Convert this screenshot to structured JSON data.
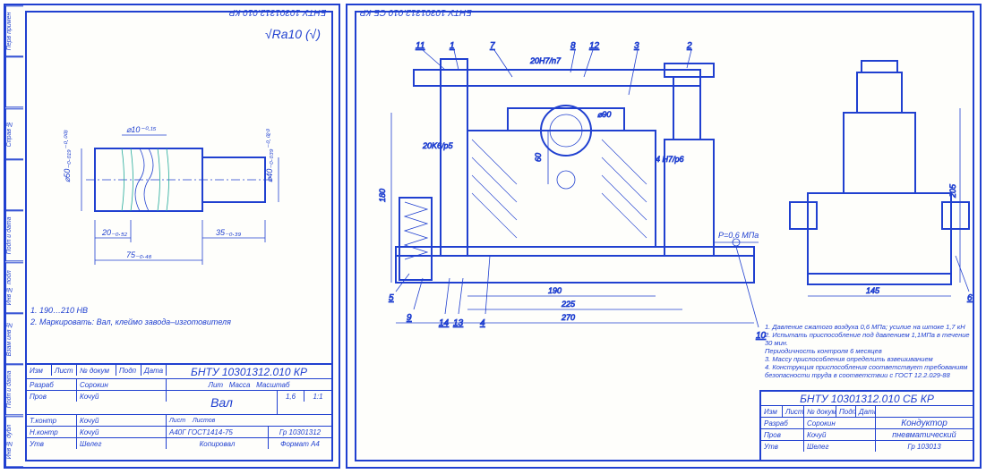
{
  "sheet_left": {
    "top_code": "БНТУ 10301312.010 КР",
    "ra_label": "Ra10",
    "dims": {
      "d10": "⌀10⁻⁰·¹⁵",
      "d50": "⌀50₋₀.₀₁₉⁻⁰·⁰⁰³",
      "d40": "⌀40₋₀.₀₃₉⁻⁰·⁰²⁰",
      "l20": "20₋₀.₅₂",
      "l35": "35₋₀.₃₉",
      "l75": "75₋₀.₄₆"
    },
    "notes": {
      "n1": "1. 190…210 HB",
      "n2": "2. Маркировать: Вал, клеймо завода–изготовителя"
    },
    "title_block": {
      "code": "БНТУ 10301312.010 КР",
      "name": "Вал",
      "material": "А40Г ГОСТ1414-75",
      "group": "Гр 10301312",
      "mass": "1,6",
      "scale": "1:1",
      "format": "А4",
      "rows": {
        "r1_1": "Изм",
        "r1_2": "Лист",
        "r1_3": "№ докум",
        "r1_4": "Подп",
        "r1_5": "Дата",
        "r2_1": "Разраб",
        "r2_2": "Сорокин",
        "r3_1": "Пров",
        "r3_2": "Кочуй",
        "r4_1": "Т.контр",
        "r4_2": "Кочуй",
        "r5_1": "Н.контр",
        "r5_2": "Кочуй",
        "r6_1": "Утв",
        "r6_2": "Шелег"
      },
      "head_lit": "Лит",
      "head_mass": "Масса",
      "head_scale": "Масштаб",
      "head_list": "Лист",
      "head_lists": "Листов",
      "copy": "Копировал"
    },
    "side_tabs": [
      "Перв примен",
      "",
      "Справ №",
      "",
      "Подп и дата",
      "Инв № подл",
      "Взам инв №",
      "Подп и дата",
      "Инв № дубл"
    ]
  },
  "sheet_right": {
    "top_code": "БНТУ 10301312.010 СБ КР",
    "leaders": {
      "l1": "1",
      "l2": "2",
      "l3": "3",
      "l4": "4",
      "l5": "5",
      "l6": "6",
      "l7": "7",
      "l8": "8",
      "l9": "9",
      "l10": "10",
      "l11": "11",
      "l12": "12",
      "l13": "13",
      "l14": "14"
    },
    "dims": {
      "fit1": "20H7/n7",
      "fit2": "4 H7/p6",
      "fit3": "20K6/p5",
      "h60": "60",
      "h180": "180",
      "w190": "190",
      "w225": "225",
      "w270": "270",
      "w145": "145",
      "h205": "205",
      "d190": "⌀90",
      "p": "P=0,6 МПа"
    },
    "notes": {
      "n1": "1. Давление сжатого воздуха 0,6 МПа; усилие на штоке 1,7 кН",
      "n2": "2. Испытать приспособление под давлением 1,1МПа в течение 30 мин.",
      "n2b": "   Периодичность контроля 6 месяцев",
      "n3": "3. Массу приспособления определить взвешиванием",
      "n4": "4. Конструкция приспособления соответствует требованиям",
      "n4b": "   безопасности труда в соответствии с ГОСТ 12.2.029-88"
    },
    "title_block": {
      "code": "БНТУ 10301312.010 СБ КР",
      "name": "Кондуктор",
      "name2": "пневматический",
      "group": "Гр 103013",
      "rows": {
        "r1_1": "Изм",
        "r1_2": "Лист",
        "r1_3": "№ докум",
        "r1_4": "Подп",
        "r1_5": "Дата",
        "r2_1": "Разраб",
        "r2_2": "Сорокин",
        "r3_1": "Пров",
        "r3_2": "Кочуй",
        "r4_1": "Утв",
        "r4_2": "Шелег"
      }
    }
  }
}
